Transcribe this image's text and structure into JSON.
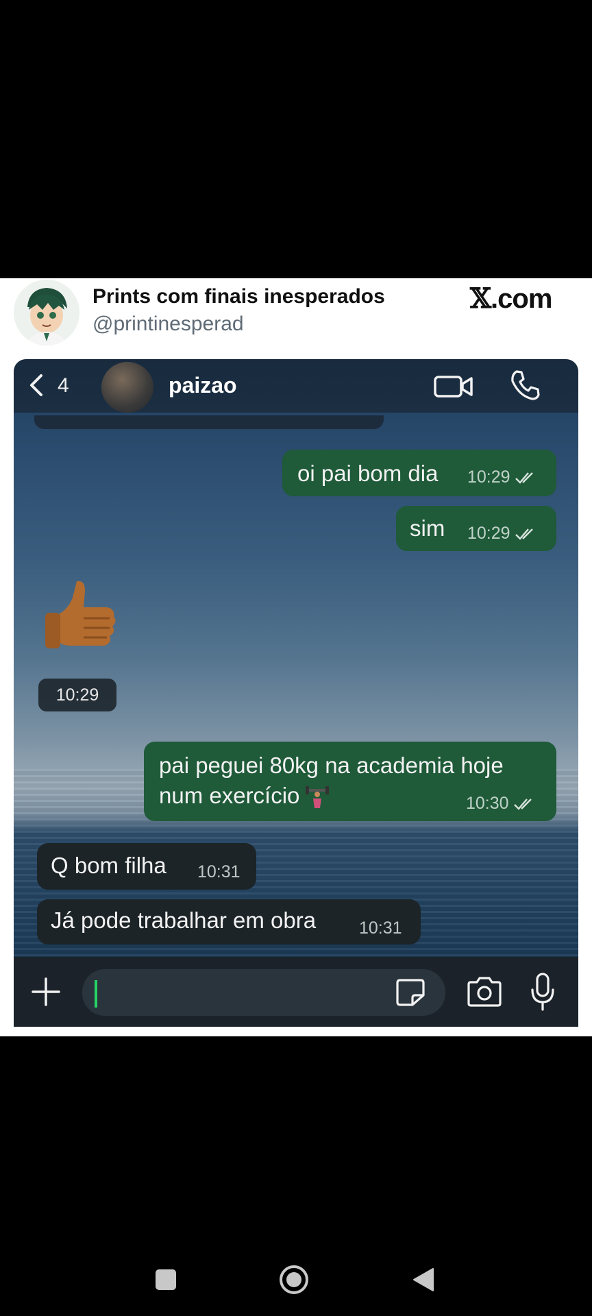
{
  "post": {
    "account_name": "Prints com finais inesperados",
    "handle": "@printinesperad",
    "brand_x": "𝕏",
    "brand_rest": ".com"
  },
  "chat": {
    "back_count": "4",
    "contact_name": "paizao",
    "messages": [
      {
        "side": "out",
        "text": "oi pai bom dia",
        "time": "10:29"
      },
      {
        "side": "out",
        "text": "sim",
        "time": "10:29"
      },
      {
        "side": "in",
        "type": "emoji",
        "emoji": "thumbs-up",
        "time": "10:29"
      },
      {
        "side": "out",
        "text_line1": "pai peguei 80kg na academia hoje",
        "text_line2": "num exercício",
        "emoji": "weight-lifting",
        "time": "10:30"
      },
      {
        "side": "in",
        "text": "Q bom filha",
        "time": "10:31"
      },
      {
        "side": "in",
        "text": "Já pode trabalhar em obra",
        "time": "10:31"
      }
    ],
    "composer": {
      "placeholder": ""
    }
  },
  "colors": {
    "outgoing_bubble": "#1f5a39",
    "incoming_bubble": "#1c2428",
    "cursor": "#27d366"
  },
  "icons": [
    "back-chevron-icon",
    "video-call-icon",
    "phone-call-icon",
    "plus-icon",
    "sticker-icon",
    "camera-icon",
    "microphone-icon",
    "nav-recents-icon",
    "nav-home-icon",
    "nav-back-icon"
  ]
}
